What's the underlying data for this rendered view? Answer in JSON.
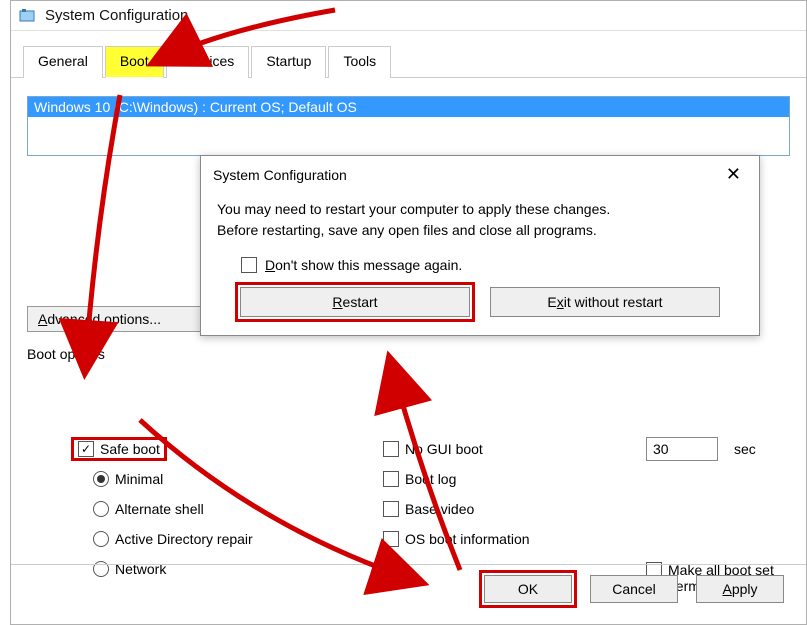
{
  "window": {
    "title": "System Configuration"
  },
  "tabs": {
    "items": [
      {
        "label": "General"
      },
      {
        "label": "Boot"
      },
      {
        "label": "Services"
      },
      {
        "label": "Startup"
      },
      {
        "label": "Tools"
      }
    ]
  },
  "os_list": {
    "selected": "Windows 10 (C:\\Windows) : Current OS; Default OS"
  },
  "advanced_options_btn": "Advanced options...",
  "boot_options": {
    "group_label": "Boot options",
    "safe_boot": {
      "label": "Safe boot",
      "checked": true
    },
    "minimal": {
      "label": "Minimal",
      "selected": true
    },
    "alt_shell": {
      "label": "Alternate shell"
    },
    "ad_repair": {
      "label": "Active Directory repair"
    },
    "network": {
      "label": "Network"
    }
  },
  "mid_options": {
    "no_gui": {
      "label": "No GUI boot"
    },
    "boot_log": {
      "label": "Boot log"
    },
    "base_vid": {
      "label": "Base video"
    },
    "os_info": {
      "label": "OS boot information"
    }
  },
  "timeout": {
    "value": "30",
    "seconds_label": "sec"
  },
  "permanent": {
    "label_line1": "Make all boot set",
    "label_line2": "permanent"
  },
  "buttons": {
    "ok": "OK",
    "cancel": "Cancel",
    "apply": "Apply"
  },
  "modal": {
    "title": "System Configuration",
    "message_line1": "You may need to restart your computer to apply these changes.",
    "message_line2": "Before restarting, save any open files and close all programs.",
    "dont_show": "Don't show this message again.",
    "restart": "Restart",
    "exit": "Exit without restart"
  },
  "colors": {
    "highlight_tab": "#ffff33",
    "selection": "#3399ff",
    "annotation": "#d00000"
  }
}
